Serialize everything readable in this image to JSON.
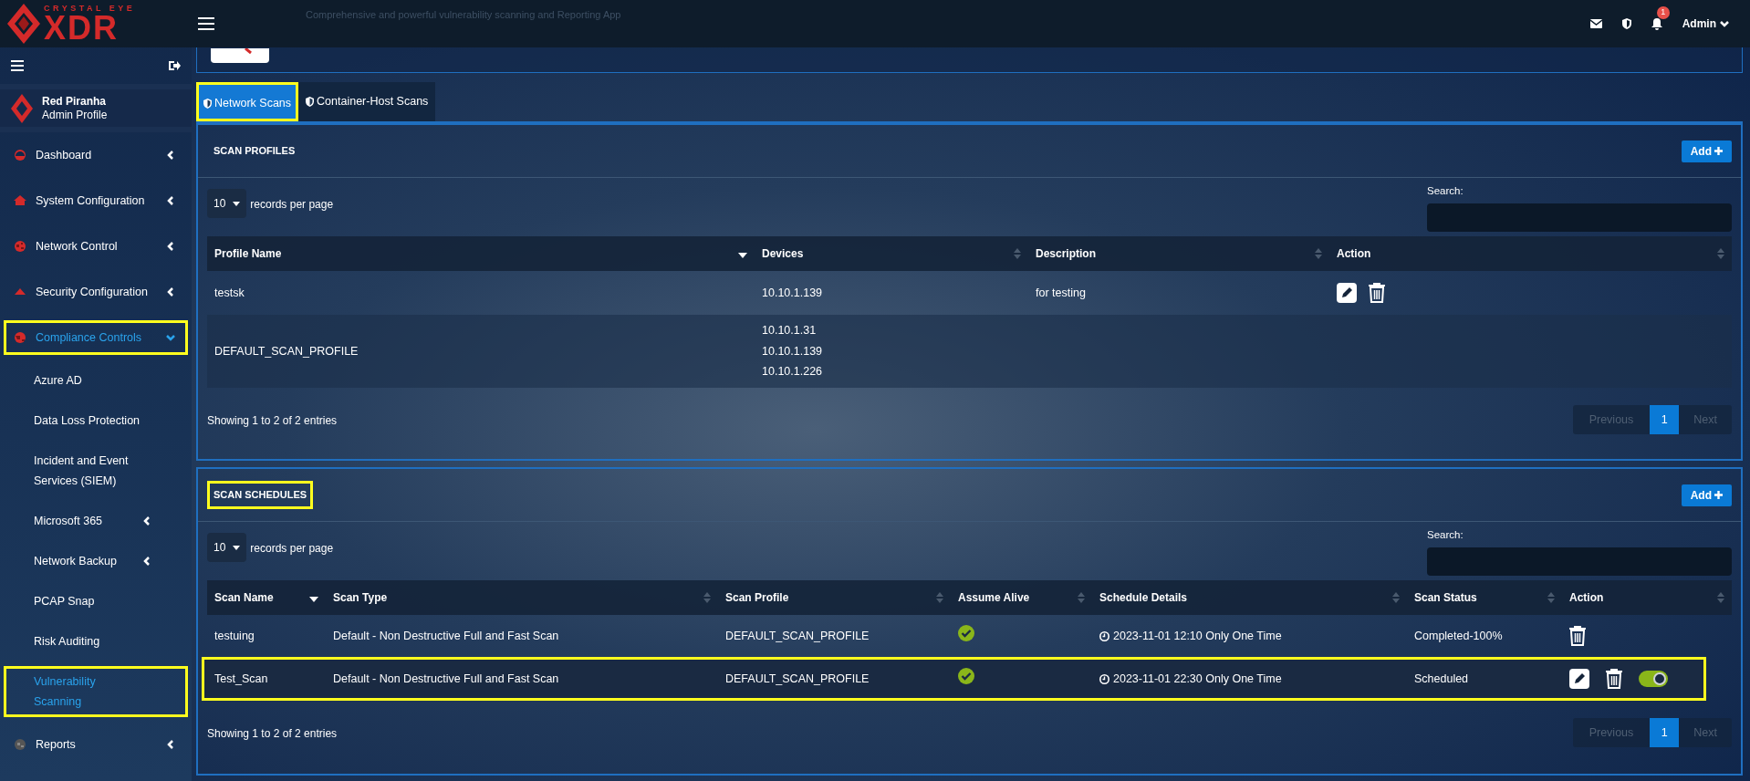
{
  "header": {
    "logo_top": "CRYSTAL EYE",
    "logo_main": "XDR",
    "app_subtitle": "Comprehensive and powerful vulnerability scanning and Reporting App",
    "notification_count": "1",
    "user": "Admin"
  },
  "sidebar": {
    "profile": {
      "name": "Red Piranha",
      "role": "Admin Profile"
    },
    "items": [
      {
        "label": "Dashboard",
        "selected": false,
        "expanded": false,
        "highlighted": false
      },
      {
        "label": "System Configuration",
        "selected": false,
        "expanded": false,
        "highlighted": false
      },
      {
        "label": "Network Control",
        "selected": false,
        "expanded": false,
        "highlighted": false
      },
      {
        "label": "Security Configuration",
        "selected": false,
        "expanded": false,
        "highlighted": false
      },
      {
        "label": "Compliance Controls",
        "selected": true,
        "expanded": true,
        "highlighted": true,
        "children": [
          {
            "label": "Azure AD",
            "kind": "link",
            "selected": false,
            "highlighted": false
          },
          {
            "label": "Data Loss Protection",
            "kind": "link",
            "selected": false,
            "highlighted": false
          },
          {
            "label": "Incident and Event Services (SIEM)",
            "kind": "link",
            "selected": false,
            "highlighted": false
          },
          {
            "label": "Microsoft 365",
            "kind": "group",
            "selected": false,
            "highlighted": false
          },
          {
            "label": "Network Backup",
            "kind": "group",
            "selected": false,
            "highlighted": false
          },
          {
            "label": "PCAP Snap",
            "kind": "link",
            "selected": false,
            "highlighted": false
          },
          {
            "label": "Risk Auditing",
            "kind": "link",
            "selected": false,
            "highlighted": false
          },
          {
            "label": "Vulnerability Scanning",
            "kind": "link",
            "selected": true,
            "highlighted": true
          }
        ]
      },
      {
        "label": "Reports",
        "selected": false,
        "expanded": false,
        "highlighted": false
      }
    ]
  },
  "tabs": [
    {
      "label": "Network Scans",
      "selected": true,
      "highlighted": true
    },
    {
      "label": "Container-Host Scans",
      "selected": false,
      "highlighted": false
    }
  ],
  "scan_profiles": {
    "title": "SCAN PROFILES",
    "highlighted": false,
    "add_button": "Add",
    "page_size": "10",
    "page_size_label": "records per page",
    "search_label": "Search:",
    "columns": [
      {
        "label": "Profile Name",
        "sorted": true
      },
      {
        "label": "Devices",
        "sorted": false
      },
      {
        "label": "Description",
        "sorted": false
      },
      {
        "label": "Action",
        "sorted": false
      }
    ],
    "rows": [
      {
        "profile_name": "testsk",
        "devices": [
          "10.10.1.139"
        ],
        "description": "for testing",
        "can_edit": true,
        "can_delete": true
      },
      {
        "profile_name": "DEFAULT_SCAN_PROFILE",
        "devices": [
          "10.10.1.31",
          "10.10.1.139",
          "10.10.1.226"
        ],
        "can_edit": false,
        "can_delete": false
      }
    ],
    "info": "Showing 1 to 2 of 2 entries",
    "pagination": {
      "previous": "Previous",
      "pages": [
        {
          "label": "1",
          "selected": true
        }
      ],
      "next": "Next"
    }
  },
  "scan_schedules": {
    "title": "SCAN SCHEDULES",
    "highlighted": true,
    "add_button": "Add",
    "page_size": "10",
    "page_size_label": "records per page",
    "search_label": "Search:",
    "columns": [
      {
        "label": "Scan Name",
        "sorted": true
      },
      {
        "label": "Scan Type",
        "sorted": false
      },
      {
        "label": "Scan Profile",
        "sorted": false
      },
      {
        "label": "Assume Alive",
        "sorted": false
      },
      {
        "label": "Schedule Details",
        "sorted": false
      },
      {
        "label": "Scan Status",
        "sorted": false
      },
      {
        "label": "Action",
        "sorted": false
      }
    ],
    "rows": [
      {
        "scan_name": "testuing",
        "scan_type": "Default - Non Destructive Full and Fast Scan",
        "scan_profile": "DEFAULT_SCAN_PROFILE",
        "assume_alive": true,
        "schedule": "2023-11-01 12:10 Only One Time",
        "status": "Completed-100%",
        "can_edit": false,
        "can_delete": true,
        "has_toggle": false,
        "highlighted": false
      },
      {
        "scan_name": "Test_Scan",
        "scan_type": "Default - Non Destructive Full and Fast Scan",
        "scan_profile": "DEFAULT_SCAN_PROFILE",
        "assume_alive": true,
        "schedule": "2023-11-01 22:30 Only One Time",
        "status": "Scheduled",
        "can_edit": true,
        "can_delete": true,
        "has_toggle": true,
        "enabled": true,
        "highlighted": true
      }
    ],
    "info": "Showing 1 to 2 of 2 entries",
    "pagination": {
      "previous": "Previous",
      "pages": [
        {
          "label": "1",
          "selected": true
        }
      ],
      "next": "Next"
    }
  }
}
